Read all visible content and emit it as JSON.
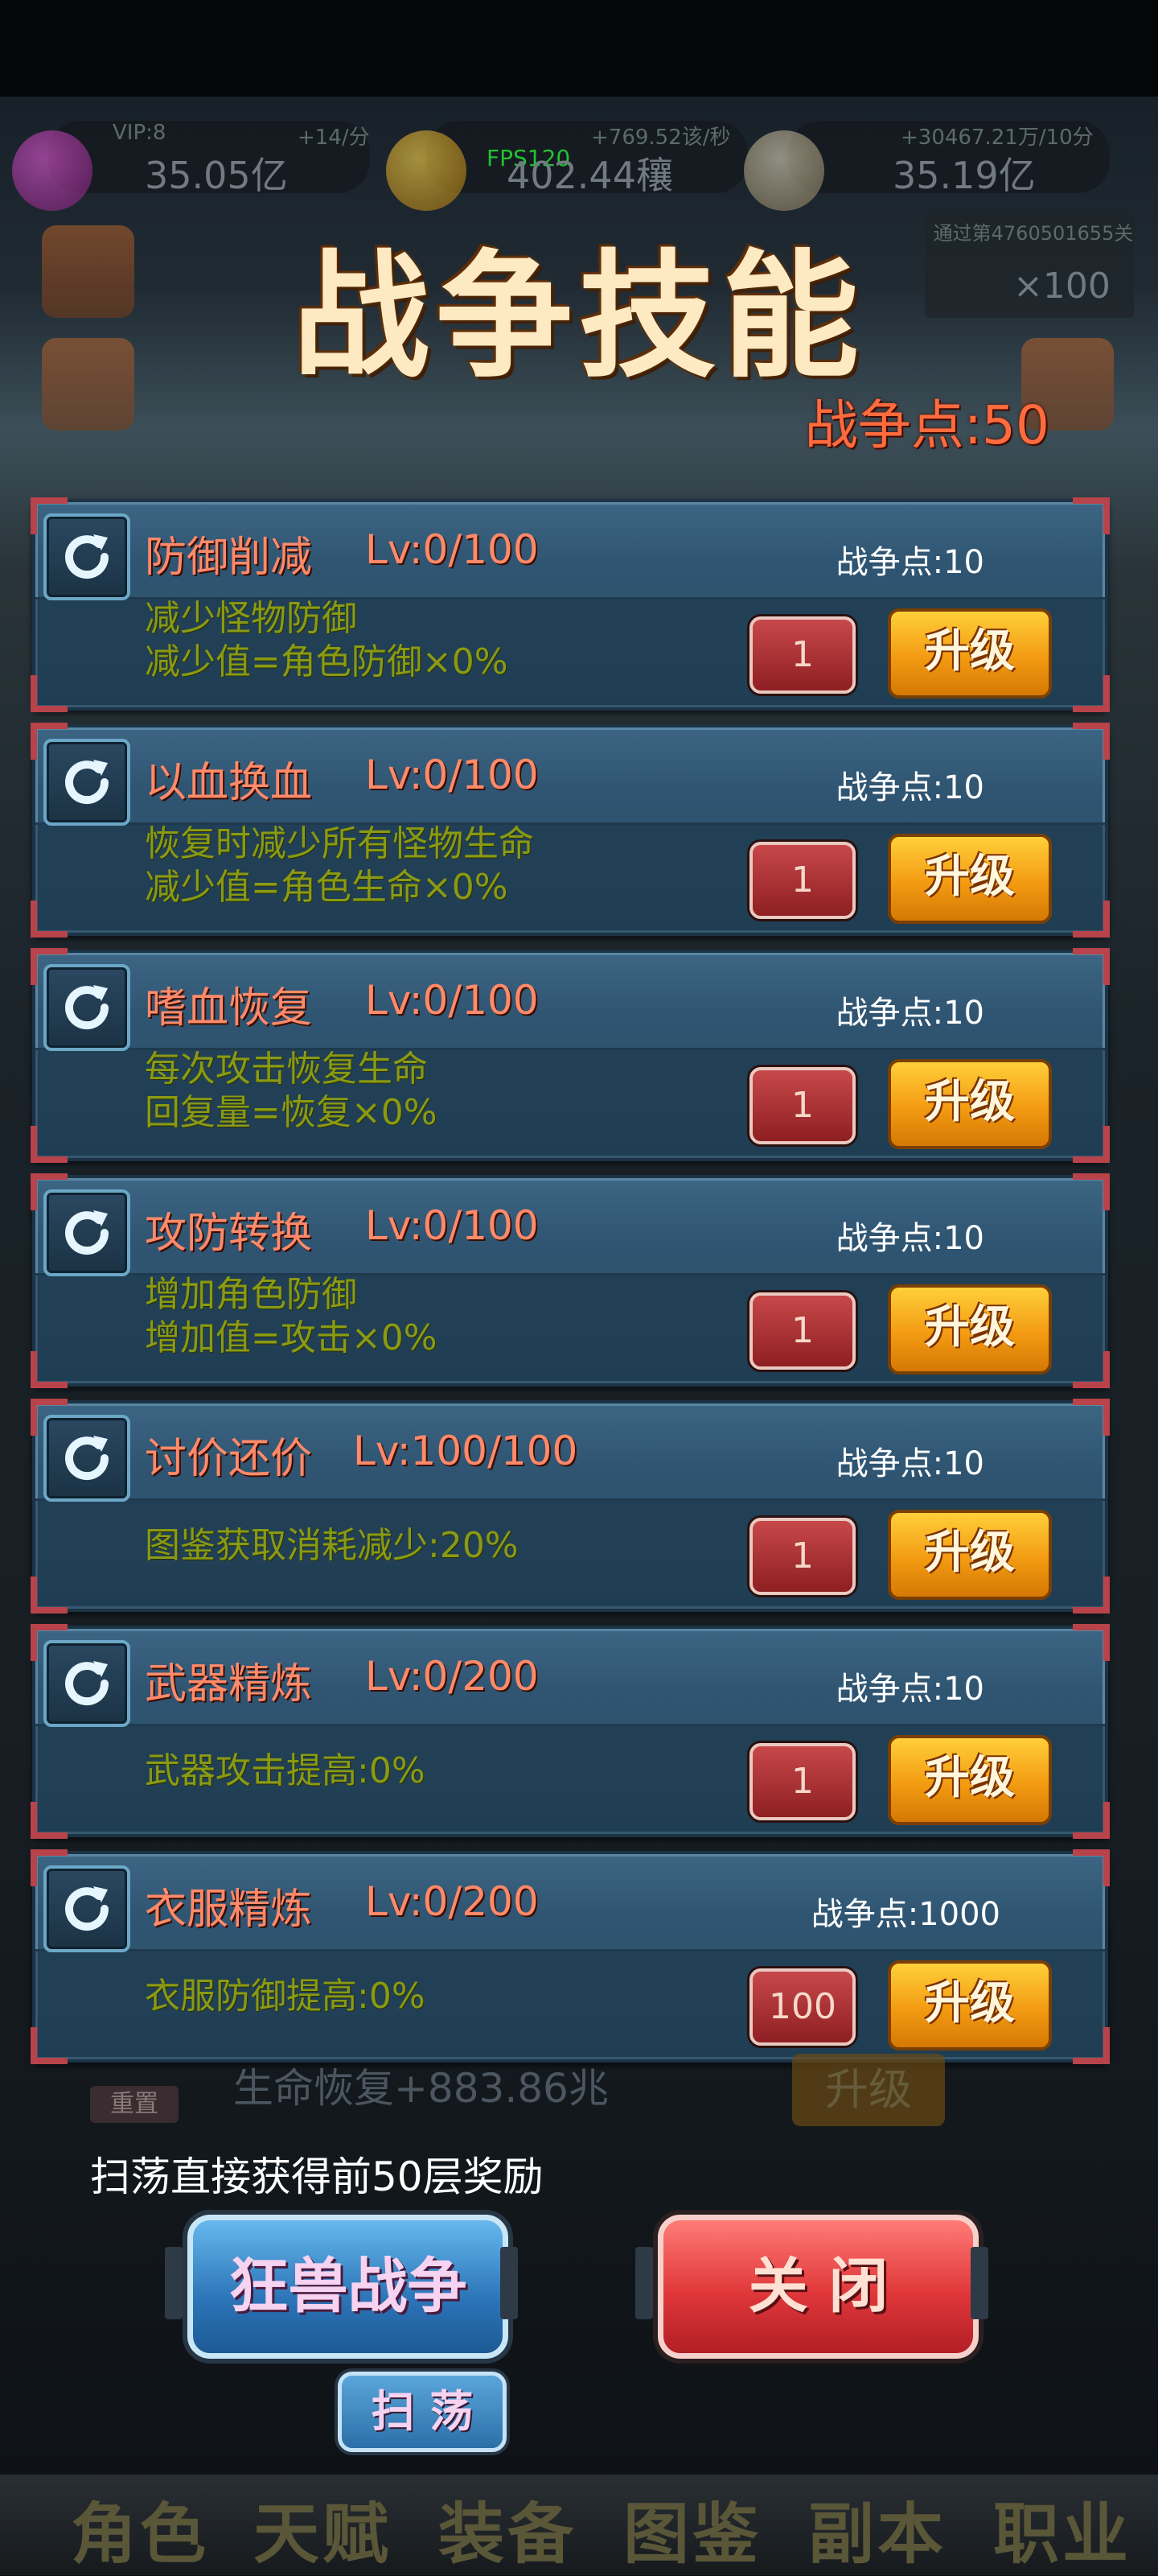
{
  "hud": {
    "vip_label": "VIP:8",
    "gem_rate": "+14/分",
    "gem_value": "35.05亿",
    "fps": "FPS120",
    "coin_rate": "+769.52该/秒",
    "coin_value": "402.44穰",
    "skull_rate": "+30467.21万/10分",
    "skull_value": "35.19亿",
    "pass_text": "通过第4760501655关",
    "pass_reward": "×100"
  },
  "panel": {
    "title": "战争技能",
    "war_points": "战争点:50"
  },
  "skills": [
    {
      "name": "防御削减",
      "level": "Lv:0/100",
      "cost": "战争点:10",
      "desc1": "减少怪物防御",
      "desc2": "减少值=角色防御×0%",
      "qty": "1",
      "upgrade": "升级"
    },
    {
      "name": "以血换血",
      "level": "Lv:0/100",
      "cost": "战争点:10",
      "desc1": "恢复时减少所有怪物生命",
      "desc2": "减少值=角色生命×0%",
      "qty": "1",
      "upgrade": "升级"
    },
    {
      "name": "嗜血恢复",
      "level": "Lv:0/100",
      "cost": "战争点:10",
      "desc1": "每次攻击恢复生命",
      "desc2": "回复量=恢复×0%",
      "qty": "1",
      "upgrade": "升级"
    },
    {
      "name": "攻防转换",
      "level": "Lv:0/100",
      "cost": "战争点:10",
      "desc1": "增加角色防御",
      "desc2": "增加值=攻击×0%",
      "qty": "1",
      "upgrade": "升级"
    },
    {
      "name": "讨价还价",
      "level": "Lv:100/100",
      "cost": "战争点:10",
      "desc1": "图鉴获取消耗减少:20%",
      "desc2": "",
      "qty": "1",
      "upgrade": "升级"
    },
    {
      "name": "武器精炼",
      "level": "Lv:0/200",
      "cost": "战争点:10",
      "desc1": "武器攻击提高:0%",
      "desc2": "",
      "qty": "1",
      "upgrade": "升级"
    },
    {
      "name": "衣服精炼",
      "level": "Lv:0/200",
      "cost": "战争点:1000",
      "desc1": "衣服防御提高:0%",
      "desc2": "",
      "qty": "100",
      "upgrade": "升级"
    }
  ],
  "background": {
    "regen_text": "生命恢复+883.86兆",
    "reset_label": "重置",
    "upgrade_ghost": "升级"
  },
  "footer": {
    "sweep_info": "扫荡直接获得前50层奖励",
    "beast_war": "狂兽战争",
    "close": "关 闭",
    "sweep": "扫 荡"
  },
  "bottom_nav": [
    "角色",
    "天赋",
    "装备",
    "图鉴",
    "副本",
    "职业"
  ],
  "colors": {
    "title": "#fde9c2",
    "war_points": "#ff6b3d",
    "skill_text": "#ff8a6a",
    "desc_text": "#8a9a14",
    "upgrade_btn": "#f39b12",
    "close_btn": "#e0373a",
    "beast_btn": "#2b74b7"
  }
}
